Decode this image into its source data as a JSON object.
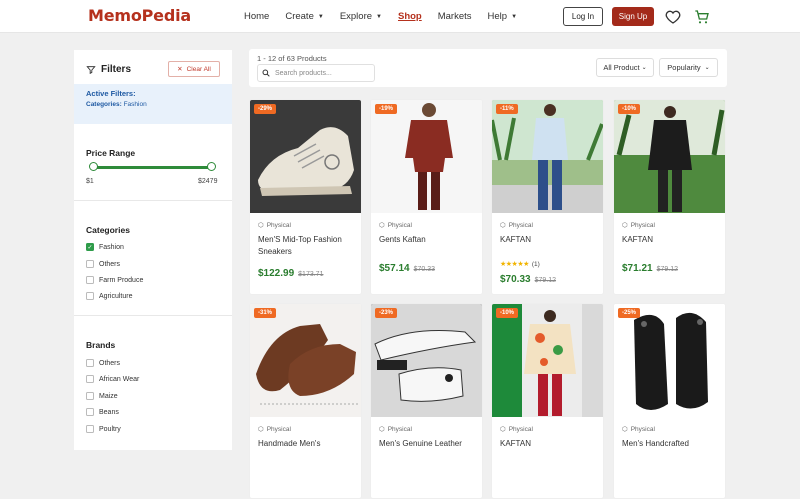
{
  "header": {
    "logo": "MemoPedia",
    "nav": [
      {
        "label": "Home",
        "caret": false,
        "active": false
      },
      {
        "label": "Create",
        "caret": true,
        "active": false
      },
      {
        "label": "Explore",
        "caret": true,
        "active": false
      },
      {
        "label": "Shop",
        "caret": false,
        "active": true
      },
      {
        "label": "Markets",
        "caret": false,
        "active": false
      },
      {
        "label": "Help",
        "caret": true,
        "active": false
      }
    ],
    "login": "Log In",
    "signup": "Sign Up"
  },
  "filters": {
    "title": "Filters",
    "clear_all": "Clear All",
    "active_title": "Active Filters:",
    "active_key": "Categories:",
    "active_value": "Fashion",
    "price_title": "Price Range",
    "price_min": "$1",
    "price_max": "$2479",
    "categories_title": "Categories",
    "categories": [
      {
        "label": "Fashion",
        "checked": true
      },
      {
        "label": "Others",
        "checked": false
      },
      {
        "label": "Farm Produce",
        "checked": false
      },
      {
        "label": "Agriculture",
        "checked": false
      }
    ],
    "brands_title": "Brands",
    "brands": [
      {
        "label": "Others"
      },
      {
        "label": "African Wear"
      },
      {
        "label": "Maize"
      },
      {
        "label": "Beans"
      },
      {
        "label": "Poultry"
      }
    ]
  },
  "results": {
    "count": "1 - 12 of 63 Products",
    "search_placeholder": "Search products...",
    "category_filter": "All Product",
    "sort": "Popularity"
  },
  "products": [
    {
      "discount": "-29%",
      "type": "Physical",
      "name": "Men'S Mid-Top Fashion Sneakers",
      "price": "$122.99",
      "old_price": "$173.71",
      "rating": "",
      "image": "sneaker-photo"
    },
    {
      "discount": "-19%",
      "type": "Physical",
      "name": "Gents Kaftan",
      "price": "$57.14",
      "old_price": "$70.33",
      "rating": "",
      "image": "kaftan-red-photo"
    },
    {
      "discount": "-11%",
      "type": "Physical",
      "name": "KAFTAN",
      "price": "$70.33",
      "old_price": "$79.12",
      "rating": "(1)",
      "image": "kaftan-blue-photo"
    },
    {
      "discount": "-10%",
      "type": "Physical",
      "name": "KAFTAN",
      "price": "$71.21",
      "old_price": "$79.12",
      "rating": "",
      "image": "kaftan-black-photo"
    },
    {
      "discount": "-31%",
      "type": "Physical",
      "name": "Handmade Men's",
      "price": "",
      "old_price": "",
      "rating": "",
      "image": "brown-shoe-photo"
    },
    {
      "discount": "-23%",
      "type": "Physical",
      "name": "Men's Genuine Leather",
      "price": "",
      "old_price": "",
      "rating": "",
      "image": "white-sandal-photo"
    },
    {
      "discount": "-10%",
      "type": "Physical",
      "name": "KAFTAN",
      "price": "",
      "old_price": "",
      "rating": "",
      "image": "floral-shirt-photo"
    },
    {
      "discount": "-25%",
      "type": "Physical",
      "name": "Men's Handcrafted",
      "price": "",
      "old_price": "",
      "rating": "",
      "image": "black-sandal-photo"
    }
  ],
  "colors": {
    "brand": "#b5311d",
    "accent_green": "#2e8b3a",
    "discount": "#ef6a23"
  }
}
